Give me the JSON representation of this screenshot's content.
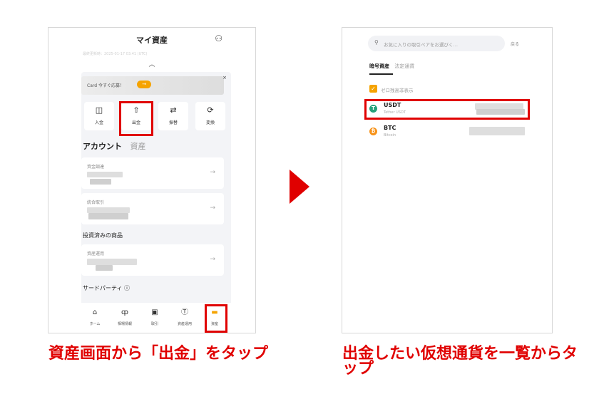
{
  "left": {
    "title": "マイ資産",
    "time_text": "最終更新時：2025-01-17 03:41 (UTC)",
    "banner": {
      "text": "Card  今すぐ応募！",
      "arrow": "→",
      "close": "×"
    },
    "actions": [
      {
        "label": "入金",
        "icon": "wallet-icon",
        "glyph": "◫"
      },
      {
        "label": "出金",
        "icon": "upload-icon",
        "glyph": "⇧"
      },
      {
        "label": "振替",
        "icon": "transfer-icon",
        "glyph": "⇄"
      },
      {
        "label": "変換",
        "icon": "convert-icon",
        "glyph": "⟳"
      }
    ],
    "tabs": {
      "account": "アカウント",
      "assets": "資産"
    },
    "accounts": [
      {
        "label": "資金調達"
      },
      {
        "label": "統合取引"
      }
    ],
    "invested_title": "投資済みの商品",
    "invested": [
      {
        "label": "資産運用"
      }
    ],
    "third_party_title": "サードパーティ ⓘ",
    "nav": [
      {
        "label": "ホーム",
        "icon": "home-icon",
        "glyph": "⌂"
      },
      {
        "label": "相場情報",
        "icon": "candlestick-icon",
        "glyph": "ȹ"
      },
      {
        "label": "取引",
        "icon": "trade-icon",
        "glyph": "▣"
      },
      {
        "label": "資産運用",
        "icon": "earn-icon",
        "glyph": "Ⓣ"
      },
      {
        "label": "資産",
        "icon": "assets-icon",
        "glyph": "▬"
      }
    ]
  },
  "right": {
    "search_placeholder": "お気に入りの取引ペアをお選びく…",
    "back": "戻る",
    "tabs": {
      "crypto": "暗号資産",
      "fiat": "法定通貨"
    },
    "hide_zero": "ゼロ残高非表示",
    "coins": [
      {
        "symbol": "USDT",
        "name": "Tether USDT",
        "color": "#26a17b",
        "glyph": "T"
      },
      {
        "symbol": "BTC",
        "name": "Bitcoin",
        "color": "#f7931a",
        "glyph": "₿"
      }
    ]
  },
  "captions": {
    "left": "資産画面から「出金」をタップ",
    "right": "出金したい仮想通貨を一覧からタップ"
  },
  "colors": {
    "highlight": "#e00000",
    "accent": "#f5a300"
  }
}
